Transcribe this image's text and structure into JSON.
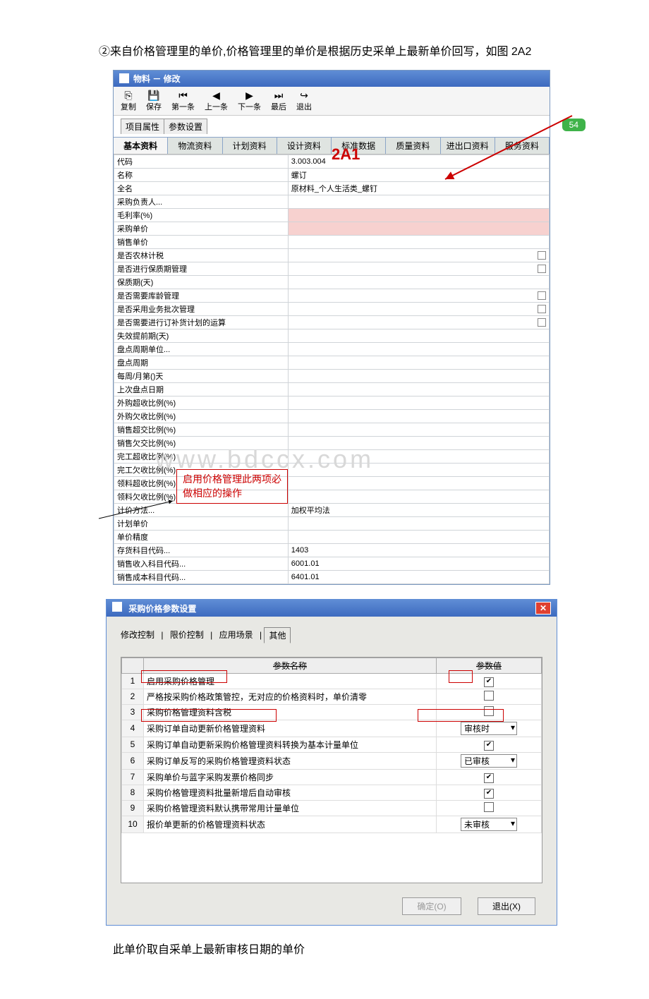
{
  "intro": "②来自价格管理里的单价,价格管理里的单价是根据历史采单上最新单价回写，如图 2A2",
  "footer": "此单价取自采单上最新审核日期的单价",
  "watermark": "www.bdccx.com",
  "badge": "54",
  "annotation_2A1": "2A1",
  "annotation_box": "启用价格管理此两项必做相应的操作",
  "window1": {
    "title": "物料 － 修改",
    "toolbar": [
      {
        "label": "复制",
        "icon": "⎘"
      },
      {
        "label": "保存",
        "icon": "💾"
      },
      {
        "label": "第一条",
        "icon": "⏮"
      },
      {
        "label": "上一条",
        "icon": "◀"
      },
      {
        "label": "下一条",
        "icon": "▶"
      },
      {
        "label": "最后",
        "icon": "⏭"
      },
      {
        "label": "退出",
        "icon": "↪"
      }
    ],
    "tabs_top": [
      "项目属性",
      "参数设置"
    ],
    "sub_tabs": [
      "基本资料",
      "物流资料",
      "计划资料",
      "设计资料",
      "标准数据",
      "质量资料",
      "进出口资料",
      "服务资料"
    ],
    "rows": [
      {
        "label": "代码",
        "value": "3.003.004"
      },
      {
        "label": "名称",
        "value": "螺订"
      },
      {
        "label": "全名",
        "value": "原材料_个人生活类_螺钉"
      },
      {
        "label": "采购负责人...",
        "value": ""
      },
      {
        "label": "毛利率(%)",
        "value": "",
        "red": true
      },
      {
        "label": "采购单价",
        "value": "",
        "red": true
      },
      {
        "label": "销售单价",
        "value": ""
      },
      {
        "label": "是否农林计税",
        "value": "",
        "check": true
      },
      {
        "label": "是否进行保质期管理",
        "value": "",
        "check": true
      },
      {
        "label": "保质期(天)",
        "value": ""
      },
      {
        "label": "是否需要库龄管理",
        "value": "",
        "check": true
      },
      {
        "label": "是否采用业务批次管理",
        "value": "",
        "check": true
      },
      {
        "label": "是否需要进行订补货计划的运算",
        "value": "",
        "check": true
      },
      {
        "label": "失效提前期(天)",
        "value": ""
      },
      {
        "label": "盘点周期单位...",
        "value": ""
      },
      {
        "label": "盘点周期",
        "value": ""
      },
      {
        "label": "每周/月第()天",
        "value": ""
      },
      {
        "label": "上次盘点日期",
        "value": ""
      },
      {
        "label": "外购超收比例(%)",
        "value": ""
      },
      {
        "label": "外购欠收比例(%)",
        "value": ""
      },
      {
        "label": "销售超交比例(%)",
        "value": ""
      },
      {
        "label": "销售欠交比例(%)",
        "value": ""
      },
      {
        "label": "完工超收比例(%)",
        "value": ""
      },
      {
        "label": "完工欠收比例(%)",
        "value": ""
      },
      {
        "label": "领料超收比例(%)",
        "value": ""
      },
      {
        "label": "领料欠收比例(%)",
        "value": ""
      },
      {
        "label": "计价方法...",
        "value": "加权平均法"
      },
      {
        "label": "计划单价",
        "value": ""
      },
      {
        "label": "单价精度",
        "value": ""
      },
      {
        "label": "存货科目代码...",
        "value": "1403"
      },
      {
        "label": "销售收入科目代码...",
        "value": "6001.01"
      },
      {
        "label": "销售成本科目代码...",
        "value": "6401.01"
      }
    ]
  },
  "window2": {
    "title": "采购价格参数设置",
    "tabs": [
      "修改控制",
      "限价控制",
      "应用场景",
      "其他"
    ],
    "headers": [
      "参数名称",
      "参数值"
    ],
    "rows": [
      {
        "idx": "1",
        "name": "启用采购价格管理",
        "type": "checkbox",
        "checked": true
      },
      {
        "idx": "2",
        "name": "严格按采购价格政策管控，无对应的价格资料时，单价清零",
        "type": "checkbox",
        "checked": false
      },
      {
        "idx": "3",
        "name": "采购价格管理资料含税",
        "type": "checkbox",
        "checked": false
      },
      {
        "idx": "4",
        "name": "采购订单自动更新价格管理资料",
        "type": "dropdown",
        "value": "审核时"
      },
      {
        "idx": "5",
        "name": "采购订单自动更新采购价格管理资料转换为基本计量单位",
        "type": "checkbox",
        "checked": true
      },
      {
        "idx": "6",
        "name": "采购订单反写的采购价格管理资料状态",
        "type": "dropdown",
        "value": "已审核"
      },
      {
        "idx": "7",
        "name": "采购单价与蓝字采购发票价格同步",
        "type": "checkbox",
        "checked": true
      },
      {
        "idx": "8",
        "name": "采购价格管理资料批量新增后自动审核",
        "type": "checkbox",
        "checked": true
      },
      {
        "idx": "9",
        "name": "采购价格管理资料默认携带常用计量单位",
        "type": "checkbox",
        "checked": false
      },
      {
        "idx": "10",
        "name": "报价单更新的价格管理资料状态",
        "type": "dropdown",
        "value": "未审核"
      }
    ],
    "buttons": {
      "ok": "确定(O)",
      "exit": "退出(X)"
    }
  }
}
